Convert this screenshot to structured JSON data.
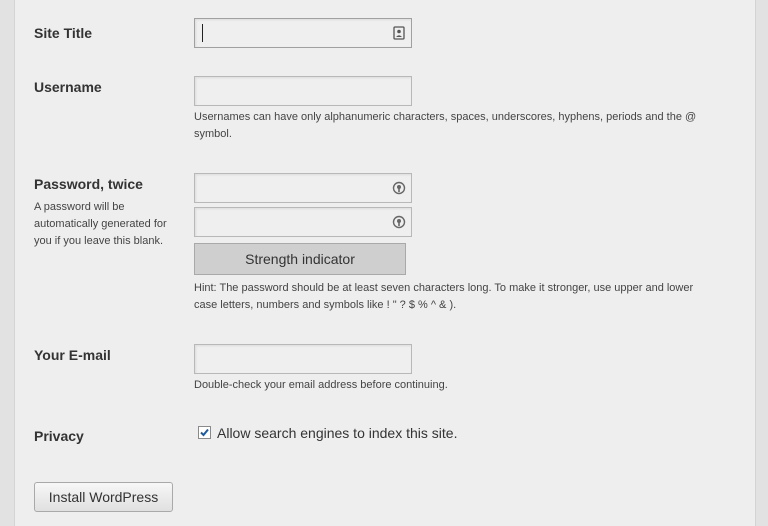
{
  "form": {
    "site_title": {
      "label": "Site Title",
      "value": ""
    },
    "username": {
      "label": "Username",
      "value": "",
      "hint": "Usernames can have only alphanumeric characters, spaces, underscores, hyphens, periods and the @ symbol."
    },
    "password": {
      "label": "Password, twice",
      "description": "A password will be automatically generated for you if you leave this blank.",
      "value1": "",
      "value2": "",
      "strength_label": "Strength indicator",
      "hint": "Hint: The password should be at least seven characters long. To make it stronger, use upper and lower case letters, numbers and symbols like ! \" ? $ % ^ & )."
    },
    "email": {
      "label": "Your E-mail",
      "value": "",
      "hint": "Double-check your email address before continuing."
    },
    "privacy": {
      "label": "Privacy",
      "checkbox_label": "Allow search engines to index this site.",
      "checked": true
    },
    "submit_label": "Install WordPress"
  },
  "icons": {
    "site_title_field": "contact-card-icon",
    "password_field": "key-lock-icon"
  }
}
